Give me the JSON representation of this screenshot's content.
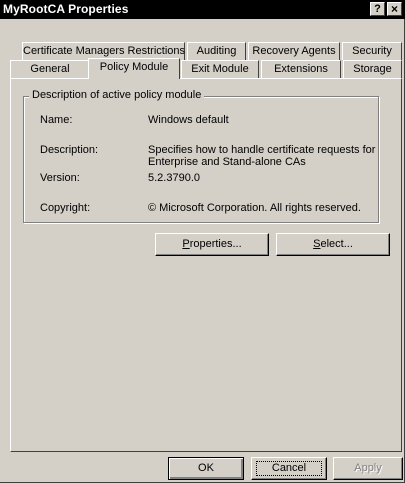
{
  "window": {
    "title": "MyRootCA Properties",
    "help_glyph": "?",
    "close_glyph": "×"
  },
  "tabs_back_row": [
    {
      "label": "Certificate Managers Restrictions"
    },
    {
      "label": "Auditing"
    },
    {
      "label": "Recovery Agents"
    },
    {
      "label": "Security"
    }
  ],
  "tabs_front_row": [
    {
      "label": "General"
    },
    {
      "label": "Policy Module",
      "selected": true
    },
    {
      "label": "Exit Module"
    },
    {
      "label": "Extensions"
    },
    {
      "label": "Storage"
    }
  ],
  "group": {
    "legend": "Description of active policy module",
    "name_label": "Name:",
    "name_value": "Windows default",
    "description_label": "Description:",
    "description_line1": "Specifies how to handle certificate requests for",
    "description_line2": "Enterprise and Stand-alone CAs",
    "version_label": "Version:",
    "version_value": "5.2.3790.0",
    "copyright_label": "Copyright:",
    "copyright_value": "© Microsoft Corporation. All rights reserved."
  },
  "actions": {
    "properties_mnemonic": "P",
    "properties_rest": "roperties...",
    "select_mnemonic": "S",
    "select_rest": "elect..."
  },
  "footer": {
    "ok_label": "OK",
    "cancel_label": "Cancel",
    "apply_label": "Apply"
  },
  "icons": {
    "help": "help-icon",
    "close": "close-icon"
  },
  "colors": {
    "face": "#d4d0c8",
    "titlebar": "#000000",
    "disabled_text": "#808080"
  }
}
